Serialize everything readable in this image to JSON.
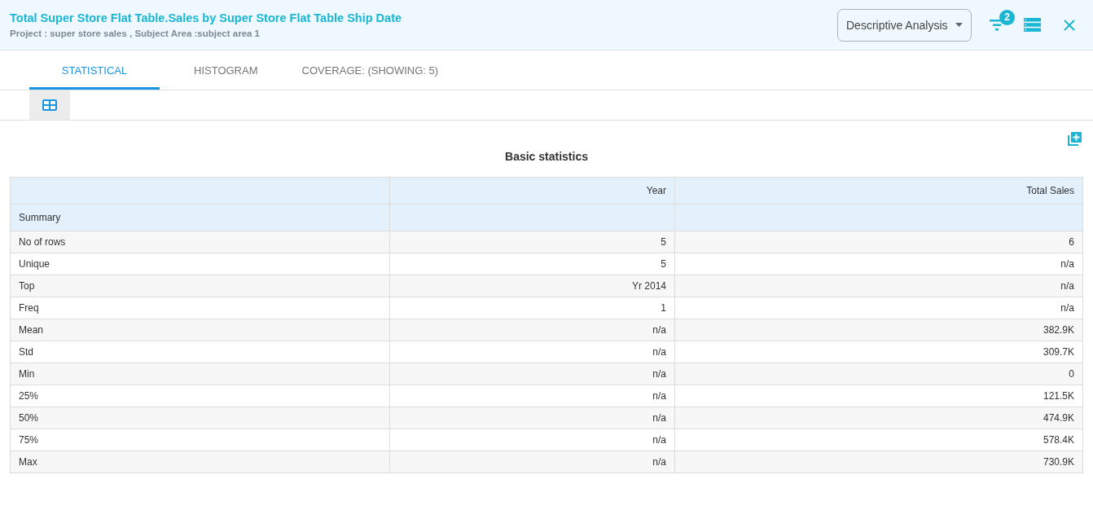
{
  "header": {
    "title": "Total Super Store Flat Table.Sales by Super Store Flat Table Ship Date",
    "subtitle": "Project : super store sales ,  Subject Area :subject area 1",
    "dropdown": "Descriptive Analysis",
    "filter_badge": "2"
  },
  "tabs": [
    {
      "label": "STATISTICAL",
      "selected": true
    },
    {
      "label": "HISTOGRAM",
      "selected": false
    },
    {
      "label": "COVERAGE: (SHOWING: 5)",
      "selected": false
    }
  ],
  "view_buttons": [
    {
      "selected": true
    }
  ],
  "table": {
    "title": "Basic statistics",
    "columns": [
      "",
      "Year",
      "Total Sales"
    ],
    "group_label": "Summary",
    "rows": [
      [
        "No of rows",
        "5",
        "6"
      ],
      [
        "Unique",
        "5",
        "n/a"
      ],
      [
        "Top",
        "Yr 2014",
        "n/a"
      ],
      [
        "Freq",
        "1",
        "n/a"
      ],
      [
        "Mean",
        "n/a",
        "382.9K"
      ],
      [
        "Std",
        "n/a",
        "309.7K"
      ],
      [
        "Min",
        "n/a",
        "0"
      ],
      [
        "25%",
        "n/a",
        "121.5K"
      ],
      [
        "50%",
        "n/a",
        "474.9K"
      ],
      [
        "75%",
        "n/a",
        "578.4K"
      ],
      [
        "Max",
        "n/a",
        "730.9K"
      ]
    ]
  }
}
